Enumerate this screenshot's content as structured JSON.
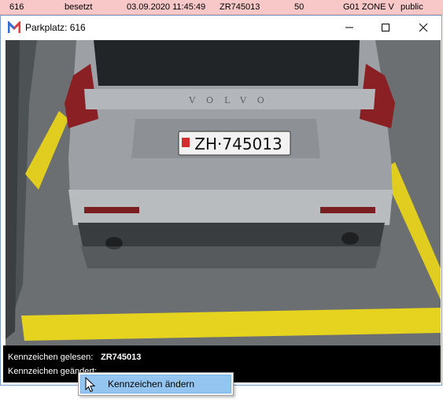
{
  "top_row": {
    "id": "616",
    "status": "besetzt",
    "timestamp": "03.09.2020 11:45:49",
    "plate": "ZR745013",
    "value": "50",
    "zone": "G01 ZONE V",
    "access": "public"
  },
  "window": {
    "title": "Parkplatz: 616",
    "icon": "app-logo-icon"
  },
  "camera": {
    "car_brand": "VOLVO",
    "license_plate_text": "ZH·745013"
  },
  "info": {
    "read_label": "Kennzeichen gelesen:",
    "read_value": "ZR745013",
    "changed_label": "Kennzeichen geändert:"
  },
  "context_menu": {
    "items": [
      {
        "label": "Kennzeichen ändern"
      }
    ]
  },
  "colors": {
    "top_row_bg": "#f8c8c8",
    "menu_highlight": "#93c5f0",
    "parking_line": "#e8d21e"
  }
}
